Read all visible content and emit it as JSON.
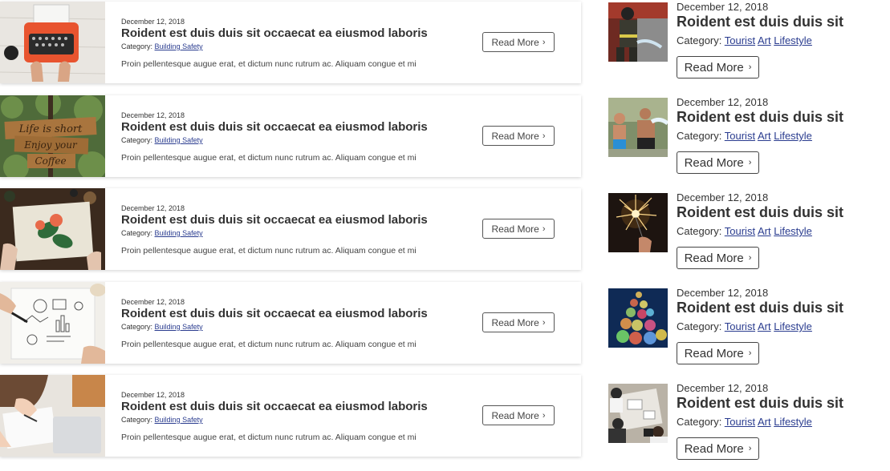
{
  "left_cards": [
    {
      "date": "December 12, 2018",
      "title": "Roident est duis duis sit occaecat ea eiusmod laboris",
      "category_label": "Category:",
      "category_link": "Building Safety",
      "excerpt": "Proin pellentesque augue erat, et dictum nunc rutrum ac. Aliquam congue et mi",
      "button": "Read More",
      "image": "typewriter-photo"
    },
    {
      "date": "December 12, 2018",
      "title": "Roident est duis duis sit occaecat ea eiusmod laboris",
      "category_label": "Category:",
      "category_link": "Building Safety",
      "excerpt": "Proin pellentesque augue erat, et dictum nunc rutrum ac. Aliquam congue et mi",
      "button": "Read More",
      "image": "life-is-short-sign-photo",
      "image_text": "Life is short Enjoy your Coffee"
    },
    {
      "date": "December 12, 2018",
      "title": "Roident est duis duis sit occaecat ea eiusmod laboris",
      "category_label": "Category:",
      "category_link": "Building Safety",
      "excerpt": "Proin pellentesque augue erat, et dictum nunc rutrum ac. Aliquam congue et mi",
      "button": "Read More",
      "image": "flower-painting-photo"
    },
    {
      "date": "December 12, 2018",
      "title": "Roident est duis duis sit occaecat ea eiusmod laboris",
      "category_label": "Category:",
      "category_link": "Building Safety",
      "excerpt": "Proin pellentesque augue erat, et dictum nunc rutrum ac. Aliquam congue et mi",
      "button": "Read More",
      "image": "sketch-notebook-photo"
    },
    {
      "date": "December 12, 2018",
      "title": "Roident est duis duis sit occaecat ea eiusmod laboris",
      "category_label": "Category:",
      "category_link": "Building Safety",
      "excerpt": "Proin pellentesque augue erat, et dictum nunc rutrum ac. Aliquam congue et mi",
      "button": "Read More",
      "image": "writing-desk-photo"
    }
  ],
  "right_items": [
    {
      "date": "December 12, 2018",
      "title": "Roident est duis duis sit",
      "category_label": "Category:",
      "categories": [
        "Tourist",
        "Art",
        "Lifestyle"
      ],
      "button": "Read More",
      "image": "firefighter-photo"
    },
    {
      "date": "December 12, 2018",
      "title": "Roident est duis duis sit",
      "category_label": "Category:",
      "categories": [
        "Tourist",
        "Art",
        "Lifestyle"
      ],
      "button": "Read More",
      "image": "water-play-photo"
    },
    {
      "date": "December 12, 2018",
      "title": "Roident est duis duis sit",
      "category_label": "Category:",
      "categories": [
        "Tourist",
        "Art",
        "Lifestyle"
      ],
      "button": "Read More",
      "image": "sparkler-photo"
    },
    {
      "date": "December 12, 2018",
      "title": "Roident est duis duis sit",
      "category_label": "Category:",
      "categories": [
        "Tourist",
        "Art",
        "Lifestyle"
      ],
      "button": "Read More",
      "image": "bokeh-lights-photo"
    },
    {
      "date": "December 12, 2018",
      "title": "Roident est duis duis sit",
      "category_label": "Category:",
      "categories": [
        "Tourist",
        "Art",
        "Lifestyle"
      ],
      "button": "Read More",
      "image": "meeting-table-photo"
    }
  ],
  "colors": {
    "link": "#2a3c8f",
    "text": "#333333",
    "card_shadow": "rgba(0,0,0,0.18)"
  },
  "icons": {
    "button_arrow": "chevron-right-icon"
  }
}
